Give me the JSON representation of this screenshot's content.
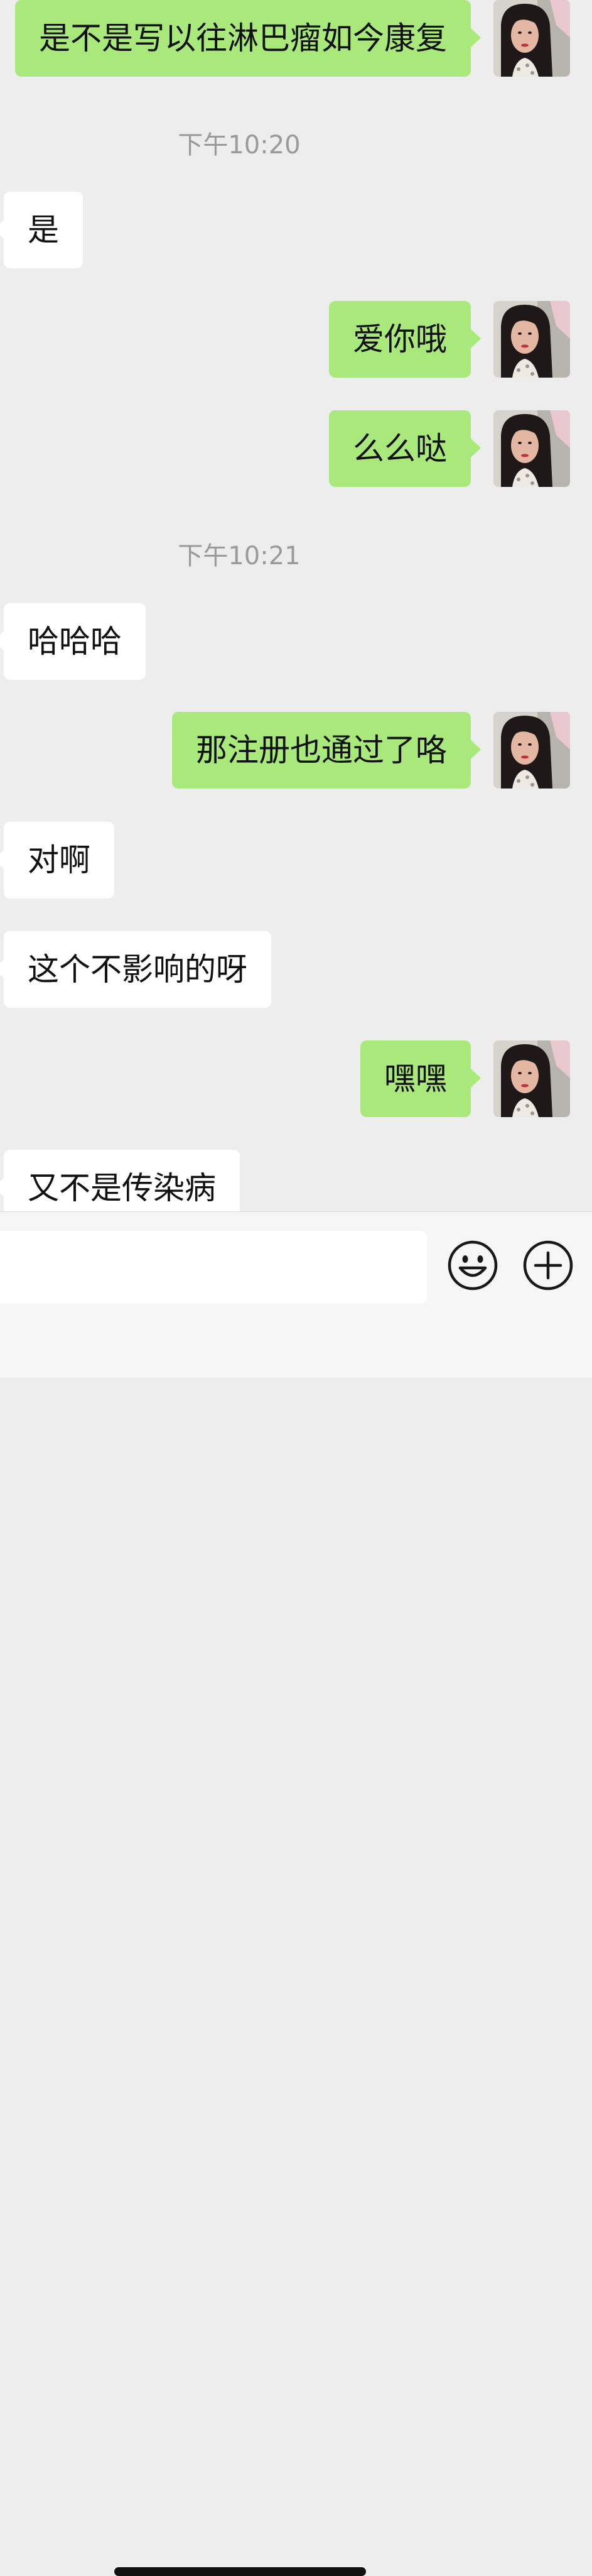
{
  "messages": [
    {
      "text": "是不是写以往淋巴瘤如今康复",
      "dir": "out"
    },
    {
      "text": "是",
      "dir": "in"
    },
    {
      "text": "爱你哦",
      "dir": "out"
    },
    {
      "text": "么么哒",
      "dir": "out"
    },
    {
      "text": "哈哈哈",
      "dir": "in"
    },
    {
      "text": "那注册也通过了咯",
      "dir": "out"
    },
    {
      "text": "对啊",
      "dir": "in"
    },
    {
      "text": "这个不影响的呀",
      "dir": "in"
    },
    {
      "text": "嘿嘿",
      "dir": "out"
    },
    {
      "text": "又不是传染病",
      "dir": "in"
    }
  ],
  "timestamps": [
    "下午10:20",
    "下午10:21"
  ],
  "input": {
    "value": "",
    "placeholder": ""
  },
  "icons": {
    "emoji": "emoji-smiley-icon",
    "more": "plus-circle-icon"
  },
  "colors": {
    "background": "#ededed",
    "outgoing_bubble": "#a9e97c",
    "incoming_bubble": "#ffffff",
    "timestamp_text": "#9a9a9a"
  }
}
